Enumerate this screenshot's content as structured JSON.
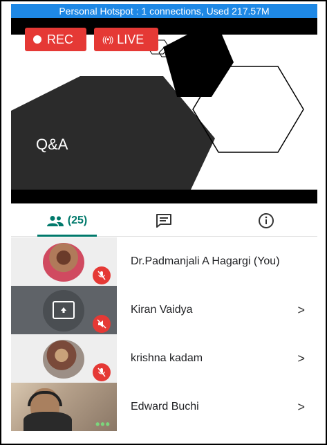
{
  "status_bar": {
    "text": "Personal Hotspot : 1 connections, Used 217.57M"
  },
  "badges": {
    "rec_label": "REC",
    "live_label": "LIVE"
  },
  "slide": {
    "title": "Q&A"
  },
  "tabs": {
    "people_count": "(25)",
    "people_icon": "people-icon",
    "chat_icon": "chat-icon",
    "info_icon": "info-icon",
    "active": "people"
  },
  "participants": [
    {
      "name": "Dr.Padmanjali A Hagargi (You)",
      "muted": true,
      "has_chevron": false
    },
    {
      "name": "Kiran Vaidya",
      "muted": true,
      "presenting": true,
      "has_chevron": true
    },
    {
      "name": "krishna kadam",
      "muted": true,
      "has_chevron": true
    },
    {
      "name": "Edward Buchi",
      "muted": false,
      "has_chevron": true
    }
  ],
  "chevron_glyph": ">",
  "colors": {
    "status_blue": "#1e88e5",
    "red": "#e53935",
    "teal": "#00796b"
  }
}
